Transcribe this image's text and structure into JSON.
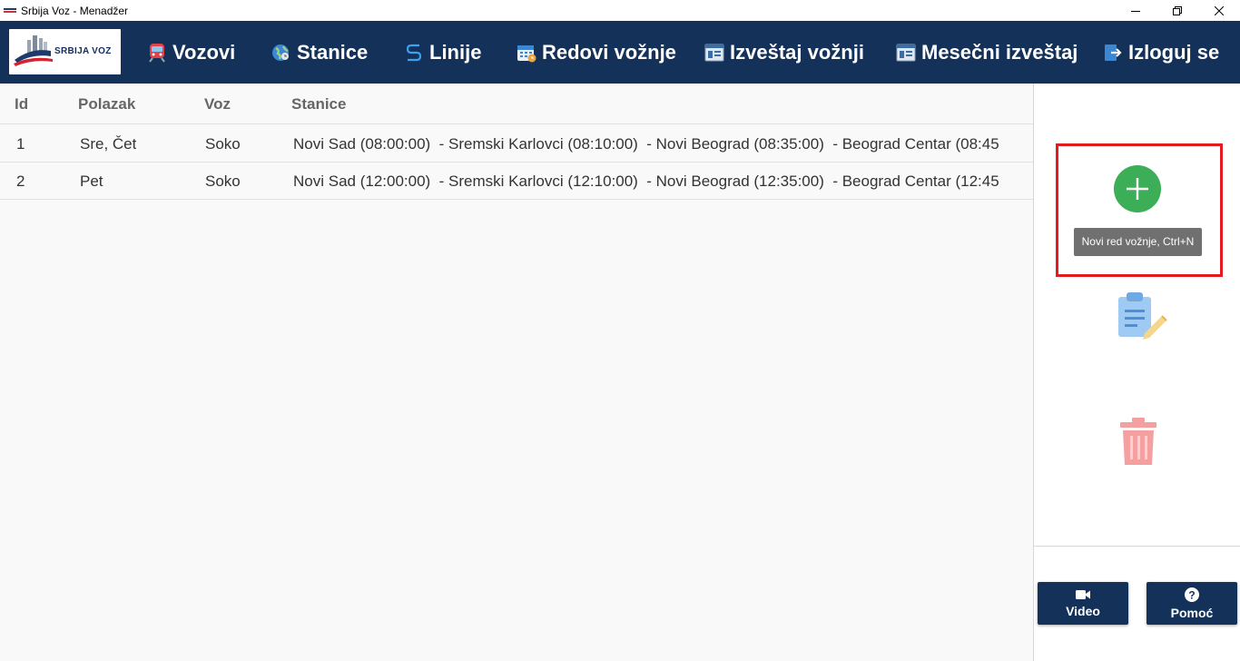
{
  "window": {
    "title": "Srbija Voz - Menadžer"
  },
  "navbar": {
    "logo_text": "SRBIJA VOZ",
    "items": [
      {
        "label": "Vozovi",
        "icon": "train-icon"
      },
      {
        "label": "Stanice",
        "icon": "globe-icon"
      },
      {
        "label": "Linije",
        "icon": "route-icon"
      },
      {
        "label": "Redovi vožnje",
        "icon": "calendar-icon"
      },
      {
        "label": "Izveštaj vožnji",
        "icon": "report-icon"
      },
      {
        "label": "Mesečni izveštaj",
        "icon": "monthly-report-icon"
      },
      {
        "label": "Izloguj se",
        "icon": "logout-icon"
      }
    ]
  },
  "table": {
    "columns": [
      "Id",
      "Polazak",
      "Voz",
      "Stanice"
    ],
    "rows": [
      {
        "id": "1",
        "polazak": "Sre, Čet",
        "voz": "Soko",
        "stanice": "Novi Sad (08:00:00)  - Sremski Karlovci (08:10:00)  - Novi Beograd (08:35:00)  - Beograd Centar (08:45"
      },
      {
        "id": "2",
        "polazak": "Pet",
        "voz": "Soko",
        "stanice": "Novi Sad (12:00:00)  - Sremski Karlovci (12:10:00)  - Novi Beograd (12:35:00)  - Beograd Centar (12:45"
      }
    ]
  },
  "side": {
    "add_tooltip": "Novi red vožnje, Ctrl+N",
    "video_label": "Video",
    "help_label": "Pomoć"
  },
  "colors": {
    "nav_bg": "#133159",
    "add_green": "#3cae57",
    "highlight_red": "#e21b23"
  }
}
